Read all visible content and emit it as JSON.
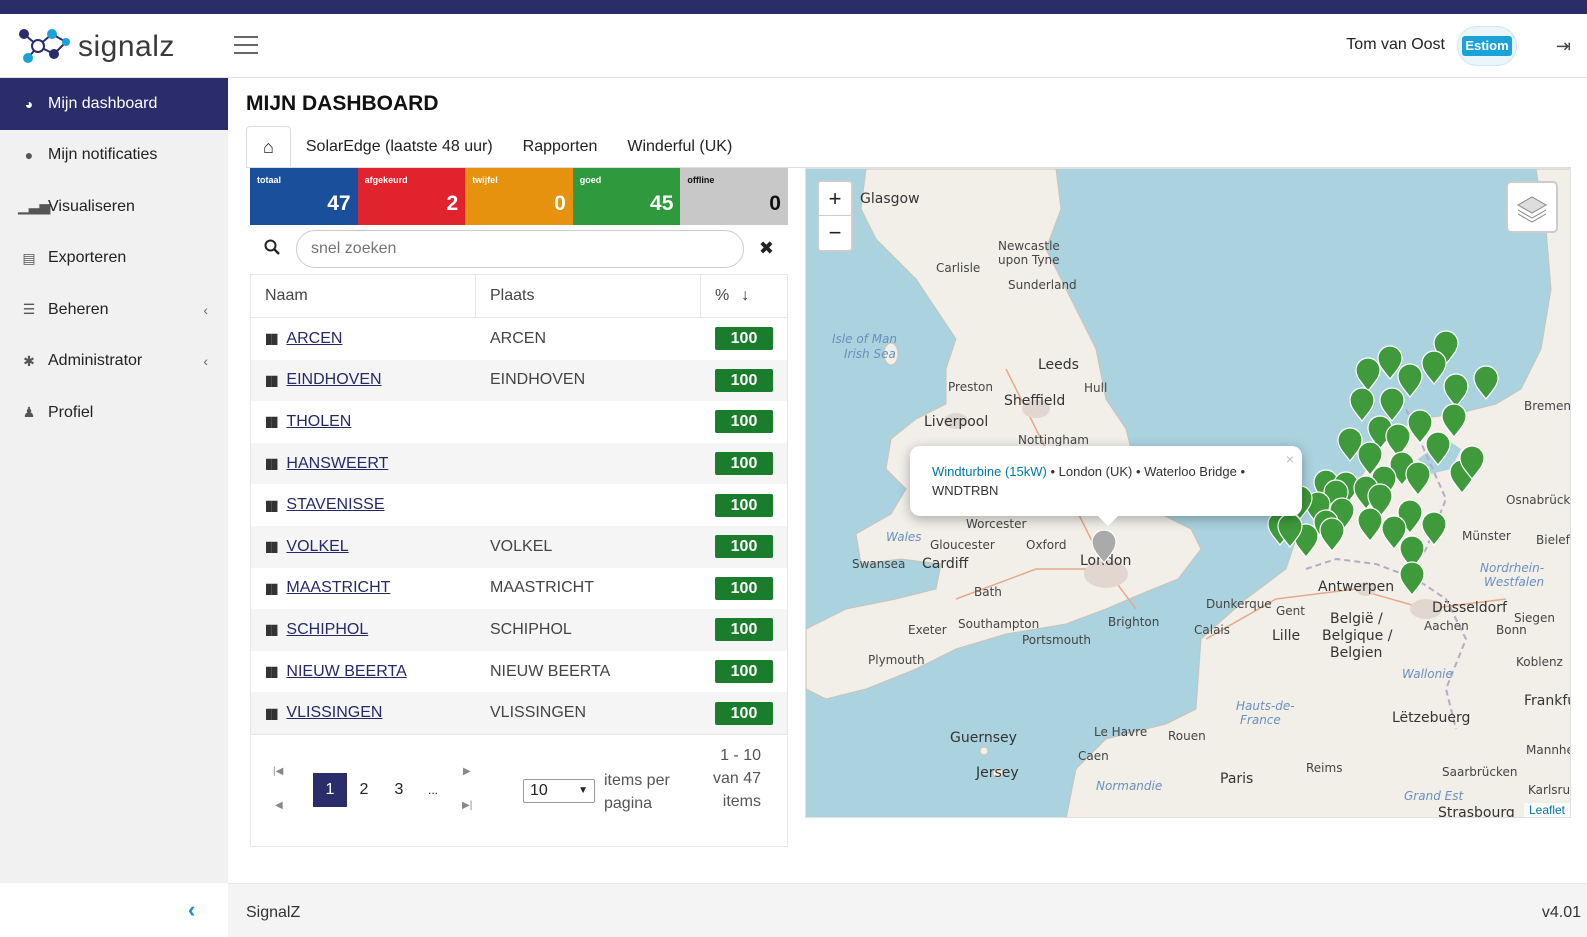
{
  "header": {
    "logo_text": "signalz",
    "user_name": "Tom van Oost",
    "company_logo": "Estiom"
  },
  "sidebar": {
    "items": [
      {
        "label": "Mijn dashboard",
        "icon": "dashboard-icon",
        "active": true
      },
      {
        "label": "Mijn notificaties",
        "icon": "comment-icon"
      },
      {
        "label": "Visualiseren",
        "icon": "signal-bars-icon"
      },
      {
        "label": "Exporteren",
        "icon": "file-excel-icon"
      },
      {
        "label": "Beheren",
        "icon": "sliders-icon",
        "caret": "‹"
      },
      {
        "label": "Administrator",
        "icon": "cog-icon",
        "caret": "‹"
      },
      {
        "label": "Profiel",
        "icon": "user-icon"
      }
    ],
    "collapse_icon": "‹"
  },
  "main": {
    "page_title": "MIJN DASHBOARD",
    "tabs": [
      {
        "label": "SolarEdge (laatste 48 uur)"
      },
      {
        "label": "Rapporten"
      },
      {
        "label": "Winderful (UK)"
      }
    ],
    "stats": [
      {
        "label": "totaal",
        "value": "47",
        "color": "#1a4f9c"
      },
      {
        "label": "afgekeurd",
        "value": "2",
        "color": "#e0232d"
      },
      {
        "label": "twijfel",
        "value": "0",
        "color": "#e6920e"
      },
      {
        "label": "goed",
        "value": "45",
        "color": "#2f9a3d"
      },
      {
        "label": "offline",
        "value": "0",
        "color": "#c8c8c8"
      }
    ],
    "search": {
      "placeholder": "snel zoeken"
    },
    "table": {
      "columns": [
        "Naam",
        "Plaats",
        "%"
      ],
      "sort_icon": "↓",
      "rows": [
        {
          "name": "ARCEN",
          "place": "ARCEN",
          "pct": "100"
        },
        {
          "name": "EINDHOVEN",
          "place": "EINDHOVEN",
          "pct": "100"
        },
        {
          "name": "THOLEN",
          "place": "",
          "pct": "100"
        },
        {
          "name": "HANSWEERT",
          "place": "",
          "pct": "100"
        },
        {
          "name": "STAVENISSE",
          "place": "",
          "pct": "100"
        },
        {
          "name": "VOLKEL",
          "place": "VOLKEL",
          "pct": "100"
        },
        {
          "name": "MAASTRICHT",
          "place": "MAASTRICHT",
          "pct": "100"
        },
        {
          "name": "SCHIPHOL",
          "place": "SCHIPHOL",
          "pct": "100"
        },
        {
          "name": "NIEUW BEERTA",
          "place": "NIEUW BEERTA",
          "pct": "100"
        },
        {
          "name": "VLISSINGEN",
          "place": "VLISSINGEN",
          "pct": "100"
        }
      ]
    },
    "pager": {
      "pages": [
        "1",
        "2",
        "3",
        "..."
      ],
      "current": "1",
      "page_size": "10",
      "items_per_page": "items per pagina",
      "info": "1 - 10 van 47 items"
    },
    "map": {
      "popup": {
        "link": "Windturbine (15kW)",
        "text": " • London (UK) • Waterloo Bridge • WNDTRBN",
        "close": "×"
      },
      "attribution": "Leaflet",
      "colors": {
        "marker": "#3e9a3a",
        "selected_marker": "#aaaaaa",
        "water": "#aad3df",
        "land": "#f2efe9"
      }
    }
  },
  "footer": {
    "left": "SignalZ",
    "version": "v4.01"
  }
}
